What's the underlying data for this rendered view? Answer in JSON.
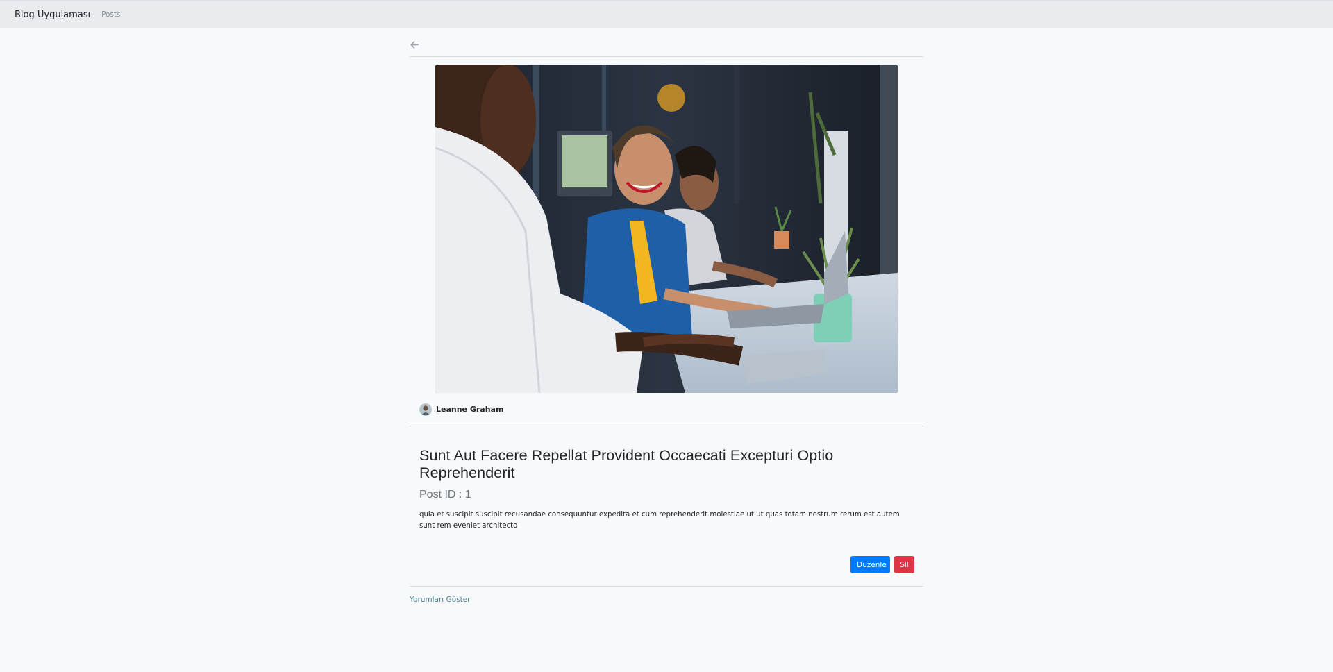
{
  "navbar": {
    "brand": "Blog Uygulaması",
    "links": [
      "Posts"
    ]
  },
  "back": {
    "icon": "arrow-left-icon"
  },
  "post": {
    "image": "office-photo",
    "author": "Leanne Graham",
    "title": "Sunt Aut Facere Repellat Provident Occaecati Excepturi Optio Reprehenderit",
    "id_label": "Post ID : 1",
    "body": "quia et suscipit suscipit recusandae consequuntur expedita et cum reprehenderit molestiae ut ut quas totam nostrum rerum est autem sunt rem eveniet architecto"
  },
  "actions": {
    "edit_label": "Düzenle",
    "delete_label": "Sil"
  },
  "comments": {
    "toggle_label": "Yorumları Göster"
  },
  "colors": {
    "primary": "#007bff",
    "danger": "#dc3545",
    "background": "#f8f9fa",
    "navbar": "#e9ecef"
  }
}
